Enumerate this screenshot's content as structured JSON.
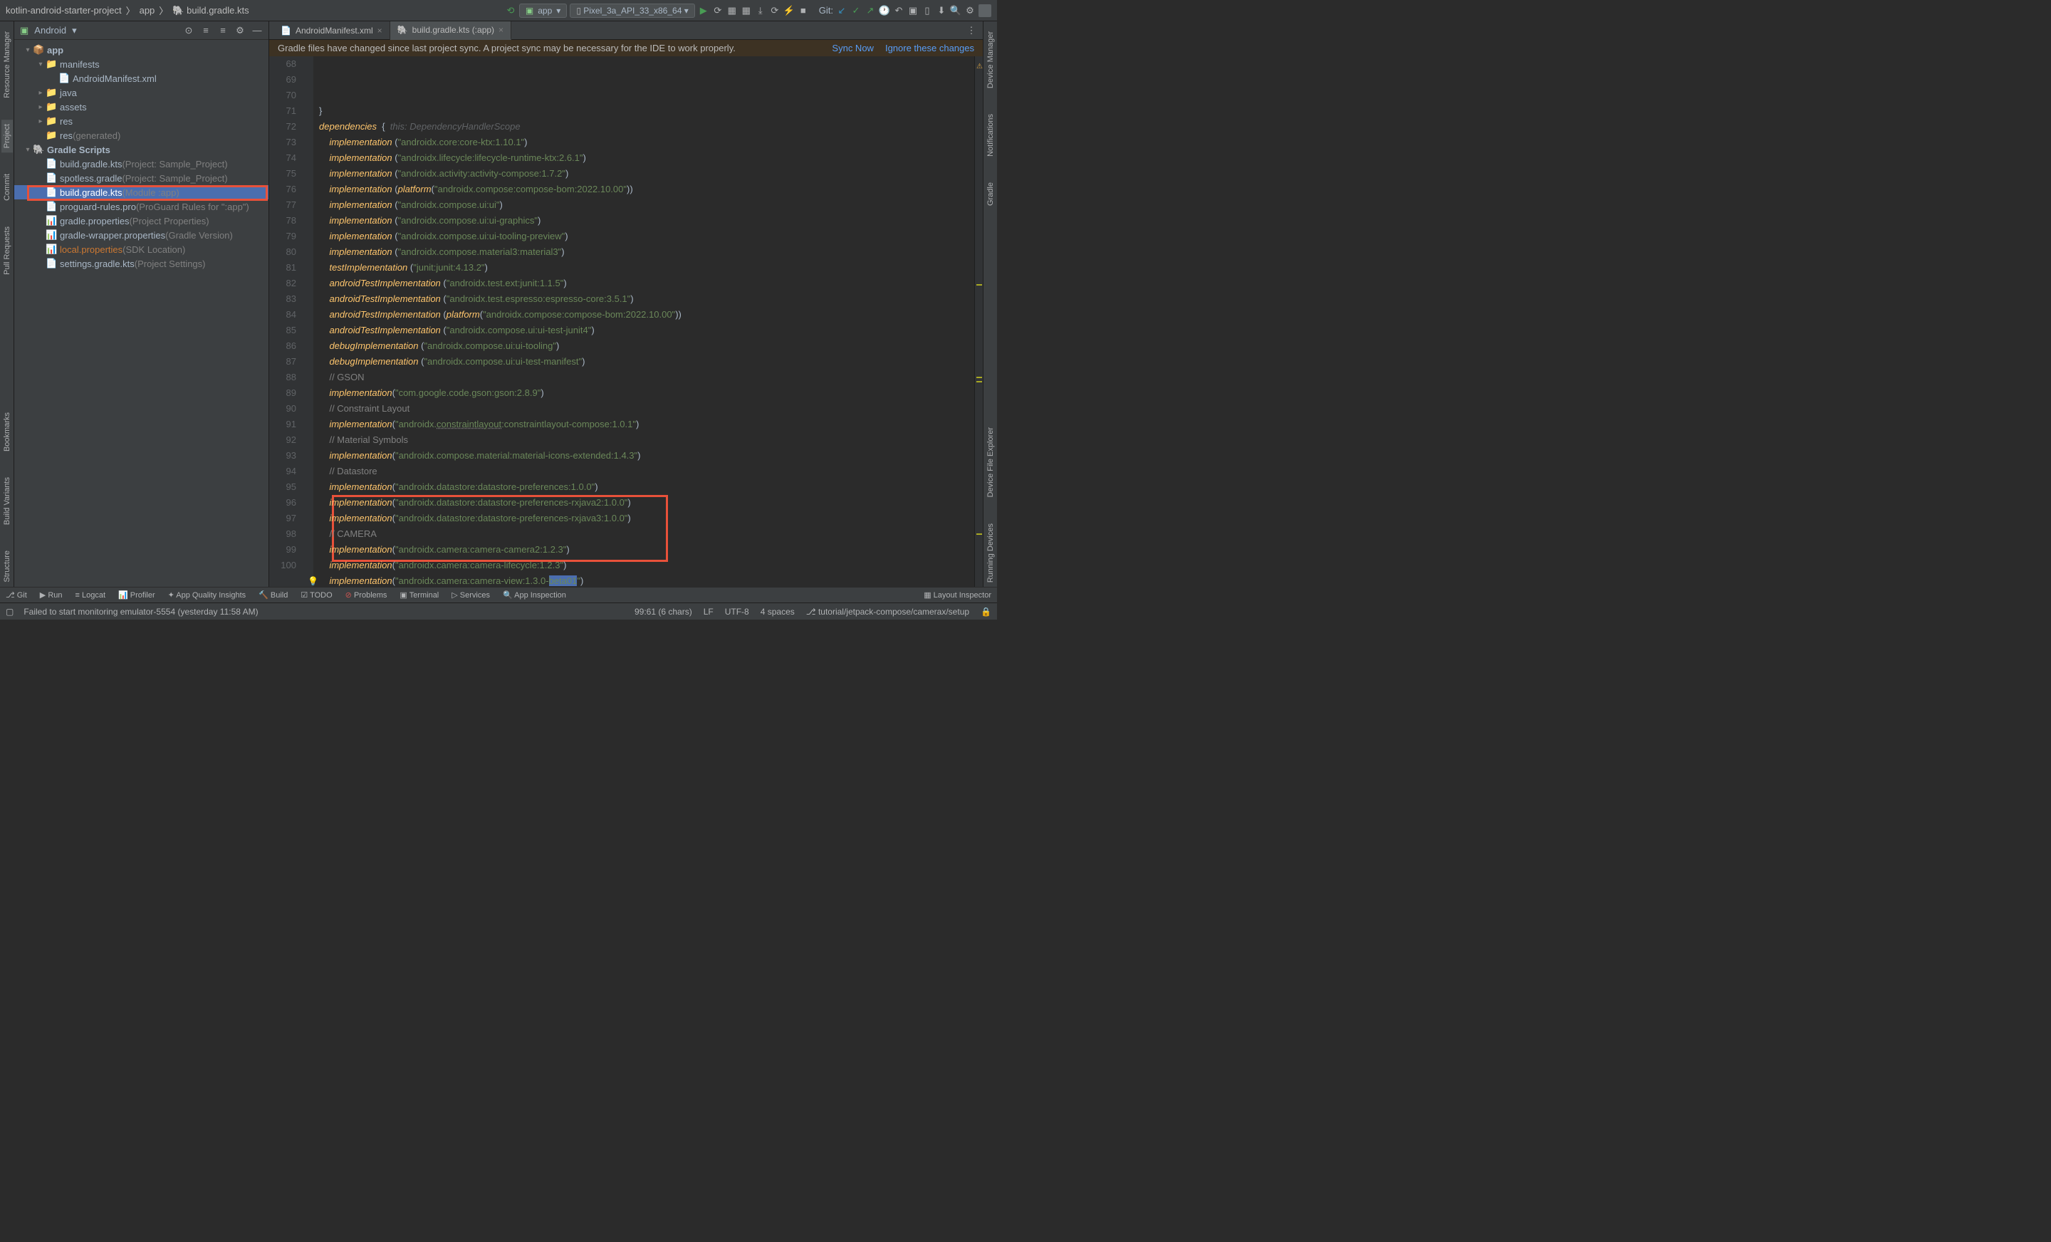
{
  "breadcrumb": [
    "kotlin-android-starter-project",
    "app",
    "build.gradle.kts"
  ],
  "run_config": "app",
  "device": "Pixel_3a_API_33_x86_64",
  "git_label": "Git:",
  "sidebar": {
    "view": "Android",
    "tree": [
      {
        "depth": 0,
        "chev": "▾",
        "ico": "📦",
        "label": "app",
        "bold": true
      },
      {
        "depth": 1,
        "chev": "▾",
        "ico": "📁",
        "label": "manifests"
      },
      {
        "depth": 2,
        "chev": "",
        "ico": "📄",
        "label": "AndroidManifest.xml"
      },
      {
        "depth": 1,
        "chev": "▸",
        "ico": "📁",
        "label": "java"
      },
      {
        "depth": 1,
        "chev": "▸",
        "ico": "📁",
        "label": "assets"
      },
      {
        "depth": 1,
        "chev": "▸",
        "ico": "📁",
        "label": "res"
      },
      {
        "depth": 1,
        "chev": "",
        "ico": "📁",
        "label": "res",
        "dim": "(generated)"
      },
      {
        "depth": 0,
        "chev": "▾",
        "ico": "🐘",
        "label": "Gradle Scripts",
        "bold": true
      },
      {
        "depth": 1,
        "chev": "",
        "ico": "📄",
        "label": "build.gradle.kts",
        "dim": "(Project: Sample_Project)"
      },
      {
        "depth": 1,
        "chev": "",
        "ico": "📄",
        "label": "spotless.gradle",
        "dim": "(Project: Sample_Project)"
      },
      {
        "depth": 1,
        "chev": "",
        "ico": "📄",
        "label": "build.gradle.kts",
        "dim": "(Module :app)",
        "selected": true
      },
      {
        "depth": 1,
        "chev": "",
        "ico": "📄",
        "label": "proguard-rules.pro",
        "dim": "(ProGuard Rules for \":app\")"
      },
      {
        "depth": 1,
        "chev": "",
        "ico": "📊",
        "label": "gradle.properties",
        "dim": "(Project Properties)"
      },
      {
        "depth": 1,
        "chev": "",
        "ico": "📊",
        "label": "gradle-wrapper.properties",
        "dim": "(Gradle Version)"
      },
      {
        "depth": 1,
        "chev": "",
        "ico": "📊",
        "label": "local.properties",
        "dim": "(SDK Location)",
        "orange": true
      },
      {
        "depth": 1,
        "chev": "",
        "ico": "📄",
        "label": "settings.gradle.kts",
        "dim": "(Project Settings)"
      }
    ]
  },
  "left_tabs": [
    "Resource Manager",
    "Project",
    "Commit",
    "Pull Requests",
    "Bookmarks",
    "Build Variants",
    "Structure"
  ],
  "right_tabs": [
    "Device Manager",
    "Notifications",
    "Gradle",
    "Device File Explorer",
    "Running Devices"
  ],
  "tabs": [
    {
      "label": "AndroidManifest.xml",
      "active": false
    },
    {
      "label": "build.gradle.kts (:app)",
      "active": true
    }
  ],
  "notice": {
    "text": "Gradle files have changed since last project sync. A project sync may be necessary for the IDE to work properly.",
    "sync": "Sync Now",
    "ignore": "Ignore these changes"
  },
  "code": {
    "first_line": 68,
    "lines": [
      {
        "n": 68,
        "t": "}"
      },
      {
        "n": 69,
        "t": ""
      },
      {
        "n": 70,
        "t": "dependencies  {",
        "hint": "this: DependencyHandlerScope"
      },
      {
        "n": 71,
        "t": "    implementation (\"androidx.core:core-ktx:1.10.1\")"
      },
      {
        "n": 72,
        "t": "    implementation (\"androidx.lifecycle:lifecycle-runtime-ktx:2.6.1\")"
      },
      {
        "n": 73,
        "t": "    implementation (\"androidx.activity:activity-compose:1.7.2\")"
      },
      {
        "n": 74,
        "t": "    implementation (platform(\"androidx.compose:compose-bom:2022.10.00\"))"
      },
      {
        "n": 75,
        "t": "    implementation (\"androidx.compose.ui:ui\")"
      },
      {
        "n": 76,
        "t": "    implementation (\"androidx.compose.ui:ui-graphics\")"
      },
      {
        "n": 77,
        "t": "    implementation (\"androidx.compose.ui:ui-tooling-preview\")"
      },
      {
        "n": 78,
        "t": "    implementation (\"androidx.compose.material3:material3\")"
      },
      {
        "n": 79,
        "t": "    testImplementation (\"junit:junit:4.13.2\")"
      },
      {
        "n": 80,
        "t": "    androidTestImplementation (\"androidx.test.ext:junit:1.1.5\")"
      },
      {
        "n": 81,
        "t": "    androidTestImplementation (\"androidx.test.espresso:espresso-core:3.5.1\")"
      },
      {
        "n": 82,
        "t": "    androidTestImplementation (platform(\"androidx.compose:compose-bom:2022.10.00\"))"
      },
      {
        "n": 83,
        "t": "    androidTestImplementation (\"androidx.compose.ui:ui-test-junit4\")"
      },
      {
        "n": 84,
        "t": "    debugImplementation (\"androidx.compose.ui:ui-tooling\")"
      },
      {
        "n": 85,
        "t": "    debugImplementation (\"androidx.compose.ui:ui-test-manifest\")"
      },
      {
        "n": 86,
        "t": "    // GSON"
      },
      {
        "n": 87,
        "t": "    implementation(\"com.google.code.gson:gson:2.8.9\")"
      },
      {
        "n": 88,
        "t": "    // Constraint Layout"
      },
      {
        "n": 89,
        "t": "    implementation(\"androidx.constraintlayout:constraintlayout-compose:1.0.1\")",
        "under": [
          "constraintlayout",
          "constraintlayout"
        ]
      },
      {
        "n": 90,
        "t": "    // Material Symbols"
      },
      {
        "n": 91,
        "t": "    implementation(\"androidx.compose.material:material-icons-extended:1.4.3\")"
      },
      {
        "n": 92,
        "t": "    // Datastore"
      },
      {
        "n": 93,
        "t": "    implementation(\"androidx.datastore:datastore-preferences:1.0.0\")"
      },
      {
        "n": 94,
        "t": "    implementation(\"androidx.datastore:datastore-preferences-rxjava2:1.0.0\")"
      },
      {
        "n": 95,
        "t": "    implementation(\"androidx.datastore:datastore-preferences-rxjava3:1.0.0\")"
      },
      {
        "n": 96,
        "t": "    // CAMERA"
      },
      {
        "n": 97,
        "t": "    implementation(\"androidx.camera:camera-camera2:1.2.3\")"
      },
      {
        "n": 98,
        "t": "    implementation(\"androidx.camera:camera-lifecycle:1.2.3\")"
      },
      {
        "n": 99,
        "t": "    implementation(\"androidx.camera:camera-view:1.3.0-beta01\")",
        "sel": "beta01",
        "bulb": true
      },
      {
        "n": 100,
        "t": "}"
      }
    ]
  },
  "bottom_tabs": [
    "Git",
    "Run",
    "Logcat",
    "Profiler",
    "App Quality Insights",
    "Build",
    "TODO",
    "Problems",
    "Terminal",
    "Services",
    "App Inspection"
  ],
  "bottom_right": "Layout Inspector",
  "status": {
    "msg": "Failed to start monitoring emulator-5554 (yesterday 11:58 AM)",
    "pos": "99:61 (6 chars)",
    "le": "LF",
    "enc": "UTF-8",
    "indent": "4 spaces",
    "branch": "tutorial/jetpack-compose/camerax/setup"
  }
}
